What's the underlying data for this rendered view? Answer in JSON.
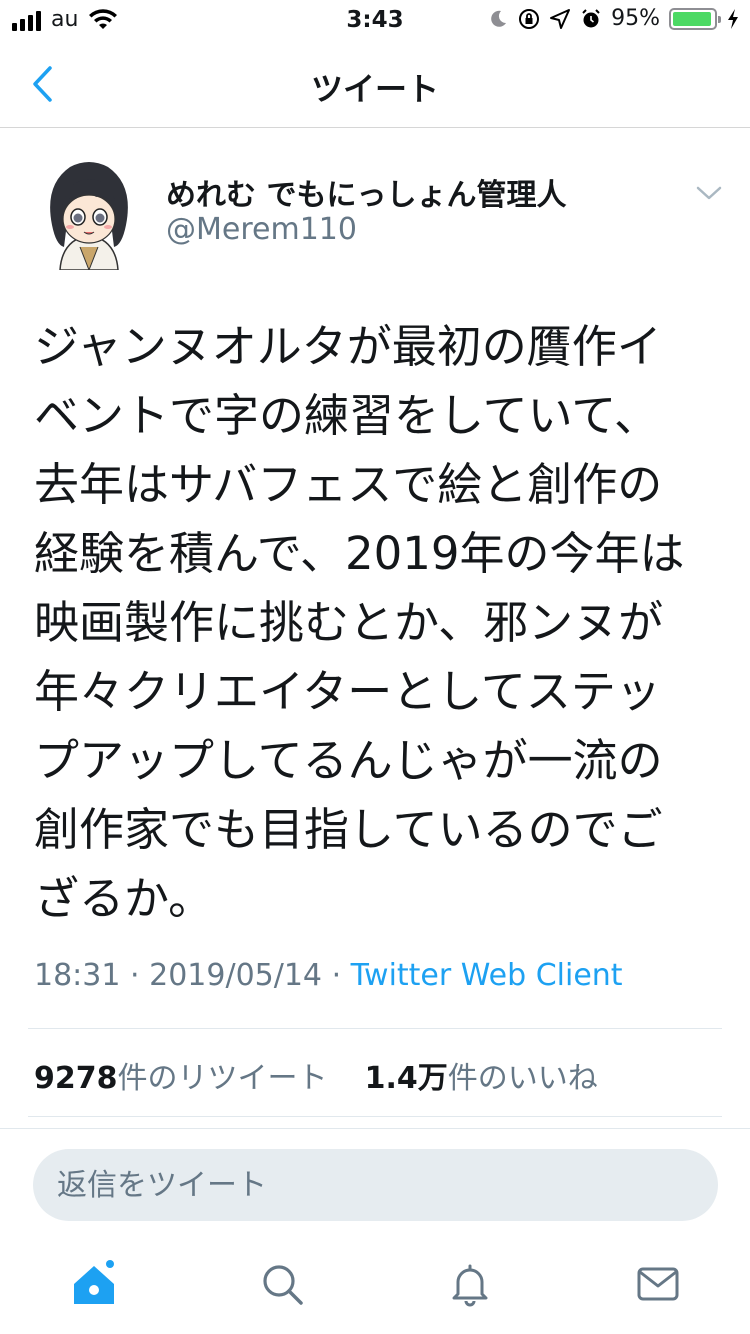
{
  "status_bar": {
    "carrier": "au",
    "time": "3:43",
    "battery_percent": "95%",
    "battery_level": 0.95,
    "icons": [
      "signal-icon",
      "wifi-icon",
      "moon-icon",
      "orientation-lock-icon",
      "location-icon",
      "alarm-icon",
      "battery-icon",
      "charging-icon"
    ]
  },
  "nav": {
    "title": "ツイート",
    "back_icon": "chevron-left-icon"
  },
  "tweet": {
    "display_name": "めれむ でもにっしょん管理人",
    "handle": "@Merem110",
    "lines": [
      "ジャンヌオルタが最初の贋作イ",
      "ベントで字の練習をしていて、",
      "去年はサバフェスで絵と創作の",
      "経験を積んで、2019年の今年は",
      "映画製作に挑むとか、邪ンヌが",
      "年々クリエイターとしてステッ",
      "プアップしてるんじゃが一流の",
      "創作家でも目指しているのでご",
      "ざるか。"
    ],
    "time": "18:31",
    "separator": "·",
    "date": "2019/05/14",
    "client": "Twitter Web Client"
  },
  "stats": {
    "retweet_count": "9278",
    "retweet_label": "件のリツイート",
    "like_count": "1.4万",
    "like_label": "件のいいね"
  },
  "reply": {
    "placeholder": "返信をツイート"
  },
  "tabs": [
    {
      "icon": "home-icon",
      "active": true,
      "has_badge": true
    },
    {
      "icon": "search-icon",
      "active": false
    },
    {
      "icon": "notifications-icon",
      "active": false
    },
    {
      "icon": "messages-icon",
      "active": false
    }
  ],
  "colors": {
    "accent": "#1da1f2",
    "text": "#14171a",
    "secondary": "#657786",
    "battery": "#4cd964"
  }
}
